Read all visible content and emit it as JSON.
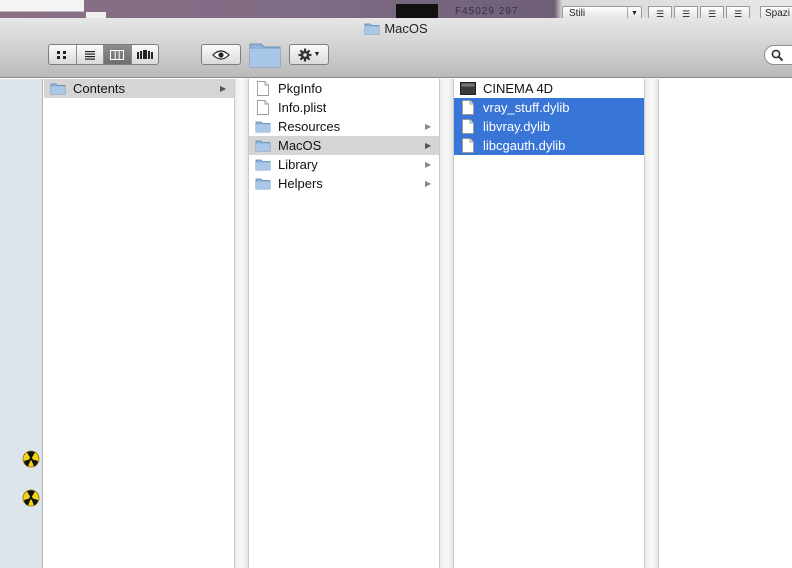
{
  "window": {
    "title": "MacOS"
  },
  "background": {
    "truncated_text": "F45029 297",
    "toolbar": {
      "style_select": "Stili",
      "extra_select": "Spazi"
    }
  },
  "toolbar": {
    "view_buttons": [
      {
        "name": "icon-view",
        "active": false
      },
      {
        "name": "list-view",
        "active": false
      },
      {
        "name": "column-view",
        "active": true
      },
      {
        "name": "coverflow-view",
        "active": false
      }
    ],
    "quicklook_icon": "eye-icon",
    "action_icon": "gear-icon",
    "search_icon": "search-icon"
  },
  "columns": [
    {
      "items": [
        {
          "label": "Contents",
          "icon": "folder",
          "selected": "gray",
          "has_children": true
        }
      ]
    },
    {
      "items": [
        {
          "label": "PkgInfo",
          "icon": "file",
          "selected": "",
          "has_children": false
        },
        {
          "label": "Info.plist",
          "icon": "file",
          "selected": "",
          "has_children": false
        },
        {
          "label": "Resources",
          "icon": "folder",
          "selected": "",
          "has_children": true
        },
        {
          "label": "MacOS",
          "icon": "folder",
          "selected": "gray",
          "has_children": true
        },
        {
          "label": "Library",
          "icon": "folder",
          "selected": "",
          "has_children": true
        },
        {
          "label": "Helpers",
          "icon": "folder",
          "selected": "",
          "has_children": true
        }
      ]
    },
    {
      "items": [
        {
          "label": "CINEMA 4D",
          "icon": "executable",
          "selected": "",
          "has_children": false
        },
        {
          "label": "vray_stuff.dylib",
          "icon": "file",
          "selected": "blue",
          "has_children": false
        },
        {
          "label": "libvray.dylib",
          "icon": "file",
          "selected": "blue",
          "has_children": false
        },
        {
          "label": "libcgauth.dylib",
          "icon": "file",
          "selected": "blue",
          "has_children": false
        }
      ]
    }
  ],
  "colors": {
    "selection_blue": "#3875d7",
    "selection_gray": "#d5d5d5",
    "sidebar": "#dde4ec",
    "folder": "#8fb3d9"
  }
}
